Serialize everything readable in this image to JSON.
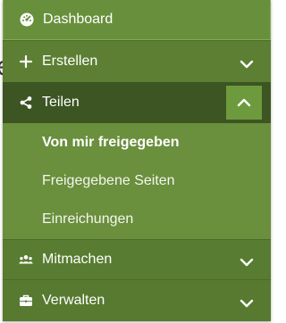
{
  "background": {
    "glyph": "e"
  },
  "menu": {
    "items": [
      {
        "label": "Dashboard",
        "icon": "dashboard-icon"
      },
      {
        "label": "Erstellen",
        "icon": "plus-icon",
        "chevron": "chevron-down-icon"
      },
      {
        "label": "Teilen",
        "icon": "share-icon",
        "chevron": "chevron-up-icon",
        "expanded": true,
        "submenu": [
          {
            "label": "Von mir freigegeben",
            "active": true
          },
          {
            "label": "Freigegebene Seiten"
          },
          {
            "label": "Einreichungen"
          }
        ]
      },
      {
        "label": "Mitmachen",
        "icon": "users-icon",
        "chevron": "chevron-down-icon"
      },
      {
        "label": "Verwalten",
        "icon": "briefcase-icon",
        "chevron": "chevron-down-icon"
      }
    ]
  },
  "colors": {
    "menu_green": "#577a32",
    "active_section": "#3c5522",
    "submenu_green": "#6a8f3d",
    "text": "#ffffff"
  }
}
